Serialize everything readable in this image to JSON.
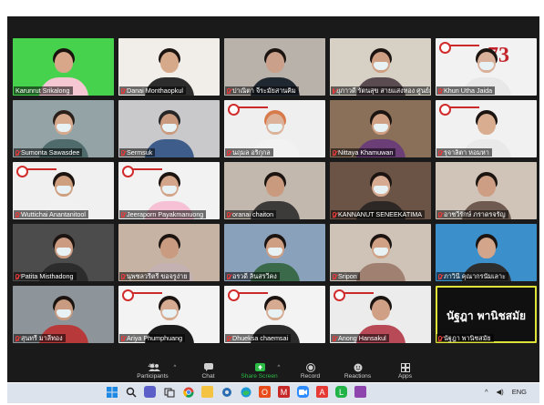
{
  "tiles": [
    {
      "name": "Karunrut Srikalong",
      "muted": false,
      "bg": "#47d24e",
      "person": {
        "skin": "#d8a688",
        "hair": "#1a120e",
        "shirt": "#f4c7d3",
        "mask": false
      }
    },
    {
      "name": "Danai Monthaopkul",
      "muted": true,
      "bg": "#f1ede8",
      "person": {
        "skin": "#d7a98b",
        "hair": "#1b1411",
        "shirt": "#2c2c2c",
        "mask": false
      }
    },
    {
      "name": "ปาณิตา จีระมัยสานคิม",
      "muted": true,
      "bg": "#b9b2aa",
      "person": {
        "skin": "#caa08a",
        "hair": "#1b1411",
        "shirt": "#1f2730",
        "mask": false
      }
    },
    {
      "name": "ยุภาวดี รัตนสุข สายแสงทอง ศูนย์การศึกษา...",
      "muted": true,
      "bg": "#d7d0c5",
      "person": {
        "skin": "#cf9f83",
        "hair": "#1b1411",
        "shirt": "#5a4b50",
        "mask": true
      }
    },
    {
      "name": "Khun Utha Jaida",
      "muted": true,
      "bg": "#f2f2f2",
      "slide": true,
      "big": "73",
      "person": {
        "skin": "#d9b09a",
        "hair": "#1b1411",
        "shirt": "#e8e8e8",
        "mask": true
      }
    },
    {
      "name": "Sumonta Sawasdee",
      "muted": true,
      "bg": "#93a3a6",
      "person": {
        "skin": "#d7aa8e",
        "hair": "#2a1f19",
        "shirt": "#4f6b6c",
        "mask": true
      }
    },
    {
      "name": "Sermsuk",
      "muted": true,
      "bg": "#c9c9cb",
      "person": {
        "skin": "#c99a7e",
        "hair": "#262626",
        "shirt": "#3e5d8a",
        "mask": true
      }
    },
    {
      "name": "นฤมล อริกุกล",
      "muted": true,
      "bg": "#efefef",
      "slide": true,
      "person": {
        "skin": "#dcb39a",
        "hair": "#d77a4c",
        "shirt": "#f2f2f2",
        "mask": true
      }
    },
    {
      "name": "Nittaya Khamuwan",
      "muted": true,
      "bg": "#8a6f59",
      "person": {
        "skin": "#cf9f83",
        "hair": "#1b1411",
        "shirt": "#6b3e78",
        "mask": true
      }
    },
    {
      "name": "รุจาลิตา หอมหา",
      "muted": true,
      "bg": "#f1f1f1",
      "slide": true,
      "person": {
        "skin": "#d9ad90",
        "hair": "#1b1411",
        "shirt": "#e9e9e9",
        "mask": false
      }
    },
    {
      "name": "Wuttichai Anantanitool",
      "muted": true,
      "bg": "#f0f0f0",
      "slide": true,
      "person": {
        "skin": "#cfa07f",
        "hair": "#1b1411",
        "shirt": "#f1f1f1",
        "mask": true
      }
    },
    {
      "name": "Jeeraporn Payakmanuong",
      "muted": true,
      "bg": "#f2f2f2",
      "slide": true,
      "person": {
        "skin": "#d3a58a",
        "hair": "#1b1411",
        "shirt": "#f6c1d4",
        "mask": true
      }
    },
    {
      "name": "oranai chaiton",
      "muted": true,
      "bg": "#c2b8ad",
      "person": {
        "skin": "#c99a7e",
        "hair": "#1b1411",
        "shirt": "#3d3a3a",
        "mask": false
      }
    },
    {
      "name": "KANNANUT SENEEKATIMA",
      "muted": true,
      "bg": "#6b5446",
      "person": {
        "skin": "#d6ab92",
        "hair": "#1b1411",
        "shirt": "#2d2825",
        "mask": true
      }
    },
    {
      "name": "อาชวีรักษ์ ภราดรจรัญ",
      "muted": true,
      "bg": "#cfc4b7",
      "person": {
        "skin": "#cd9e84",
        "hair": "#1b1411",
        "shirt": "#6e5a4e",
        "mask": false
      }
    },
    {
      "name": "Patita Misthadong",
      "muted": true,
      "bg": "#4c4c4c",
      "person": {
        "skin": "#cc9c82",
        "hair": "#1b1411",
        "shirt": "#2c2c2c",
        "mask": true
      }
    },
    {
      "name": "นุพชลวรีตรี ขอจรูง่าย",
      "muted": true,
      "bg": "#c6b3a4",
      "person": {
        "skin": "#c99b80",
        "hair": "#1b1411",
        "shirt": "#c4b1b2",
        "mask": false
      }
    },
    {
      "name": "อรวดี ลินสรวีคง",
      "muted": true,
      "bg": "#8aa1bc",
      "person": {
        "skin": "#cf9f83",
        "hair": "#1b1411",
        "shirt": "#3a6a4a",
        "mask": true
      }
    },
    {
      "name": "Sripon",
      "muted": true,
      "bg": "#cfc3b8",
      "person": {
        "skin": "#d0a185",
        "hair": "#1b1411",
        "shirt": "#a08070",
        "mask": true
      }
    },
    {
      "name": "ภาวินี คุณากรนัมเลาะ",
      "muted": true,
      "bg": "#3b8fcb",
      "person": {
        "skin": "#d3a58a",
        "hair": "#1b1411",
        "shirt": "#2d2d2d",
        "mask": false
      }
    },
    {
      "name": "สุนทรี มาลีทอง",
      "muted": true,
      "bg": "#8e959a",
      "person": {
        "skin": "#c99b80",
        "hair": "#1b1411",
        "shirt": "#b8393a",
        "mask": true
      }
    },
    {
      "name": "Ariya Phumphuang",
      "muted": true,
      "bg": "#f3f3f3",
      "slide": true,
      "person": {
        "skin": "#d6ab92",
        "hair": "#1b1411",
        "shirt": "#1b1b1b",
        "mask": true
      }
    },
    {
      "name": "Dhueksa chaemsai",
      "muted": true,
      "bg": "#f3f3f3",
      "slide": true,
      "person": {
        "skin": "#d6ab92",
        "hair": "#1b1411",
        "shirt": "#2b2b2b",
        "mask": true
      }
    },
    {
      "name": "Anong Hansakul",
      "muted": true,
      "bg": "#ececec",
      "slide": true,
      "person": {
        "skin": "#cfa085",
        "hair": "#1b1411",
        "shirt": "#b84a57",
        "mask": false
      }
    },
    {
      "name": "นัฐฎา พานิชสมัย",
      "muted": true,
      "active": true,
      "display": "นัฐฎา พานิชสมัย"
    }
  ],
  "toolbar": {
    "participants": {
      "label": "Participants",
      "count": "48"
    },
    "chat": {
      "label": "Chat"
    },
    "share": {
      "label": "Share Screen"
    },
    "record": {
      "label": "Record"
    },
    "reactions": {
      "label": "Reactions"
    },
    "apps": {
      "label": "Apps"
    },
    "colors": {
      "green": "#2cbb45",
      "text": "#cfcfcf"
    }
  },
  "taskbar": {
    "lang": "ENG",
    "icons": [
      "windows-start-icon",
      "search-icon",
      "chat-icon",
      "task-view-icon",
      "chrome-icon",
      "file-explorer-icon",
      "settings-icon",
      "edge-icon",
      "office-icon",
      "mail-icon",
      "zoom-icon",
      "acrobat-icon",
      "line-icon",
      "app-icon"
    ]
  }
}
